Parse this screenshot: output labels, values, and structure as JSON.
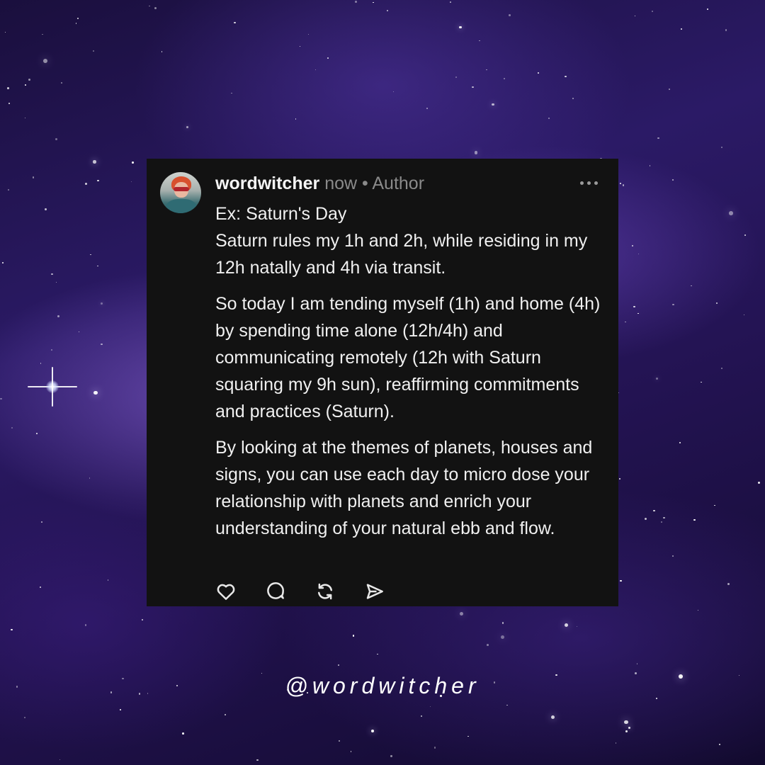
{
  "post": {
    "username": "wordwitcher",
    "time": "now",
    "separator": "•",
    "role": "Author",
    "paragraphs": [
      "Ex: Saturn's Day\nSaturn rules my 1h and 2h, while residing in my 12h natally and 4h via transit.",
      "So today I am tending myself (1h) and home (4h) by spending time alone (12h/4h) and communicating remotely (12h with Saturn squaring my 9h sun), reaffirming commitments and practices (Saturn).",
      "By looking at the themes of planets, houses and signs, you can use each day to micro dose your relationship with planets and enrich your understanding of your natural ebb and flow."
    ],
    "icons": [
      "more-options-icon",
      "heart-icon",
      "comment-icon",
      "repost-icon",
      "share-icon"
    ]
  },
  "footer": {
    "handle": "@wordwitcher"
  },
  "colors": {
    "card_background": "#121212",
    "text": "#f0f0f0",
    "muted": "#8a8a8a",
    "space_purple": "#2b1a66"
  }
}
